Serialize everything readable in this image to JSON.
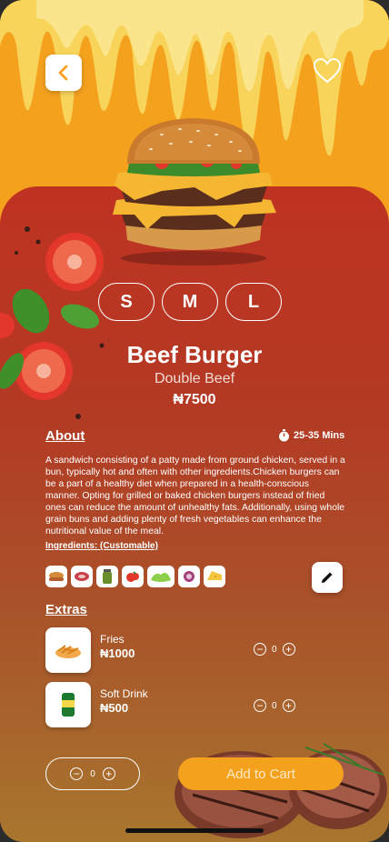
{
  "nav": {
    "back_icon": "chevron-left-icon",
    "favorite_icon": "heart-icon"
  },
  "product": {
    "name": "Beef Burger",
    "variant": "Double Beef",
    "price": "₦7500",
    "sizes": [
      "S",
      "M",
      "L"
    ]
  },
  "about": {
    "heading": "About",
    "time": "25-35 Mins",
    "description": "A sandwich consisting of a patty made from ground chicken, served in a bun, typically hot and often with other ingredients.Chicken burgers can be a part of a healthy diet when prepared in a health-conscious manner. Opting for grilled or baked chicken burgers instead of fried ones can reduce the amount of unhealthy fats. Additionally, using whole grain buns and adding plenty of fresh vegetables can enhance the nutritional value of the meal."
  },
  "ingredients": {
    "heading": "Ingredients: (Customable)",
    "items": [
      "bun-icon",
      "meat-icon",
      "pickles-jar-icon",
      "tomato-icon",
      "lettuce-icon",
      "onion-icon",
      "cheese-icon"
    ]
  },
  "extras": {
    "heading": "Extras",
    "items": [
      {
        "name": "Fries",
        "price": "₦1000",
        "qty": "0"
      },
      {
        "name": "Soft Drink",
        "price": "₦500",
        "qty": "0"
      }
    ]
  },
  "cart": {
    "qty": "0",
    "add_label": "Add to Cart"
  },
  "colors": {
    "accent": "#f4a11e",
    "panel_top": "#bf3222",
    "panel_bottom": "#a8762e"
  }
}
